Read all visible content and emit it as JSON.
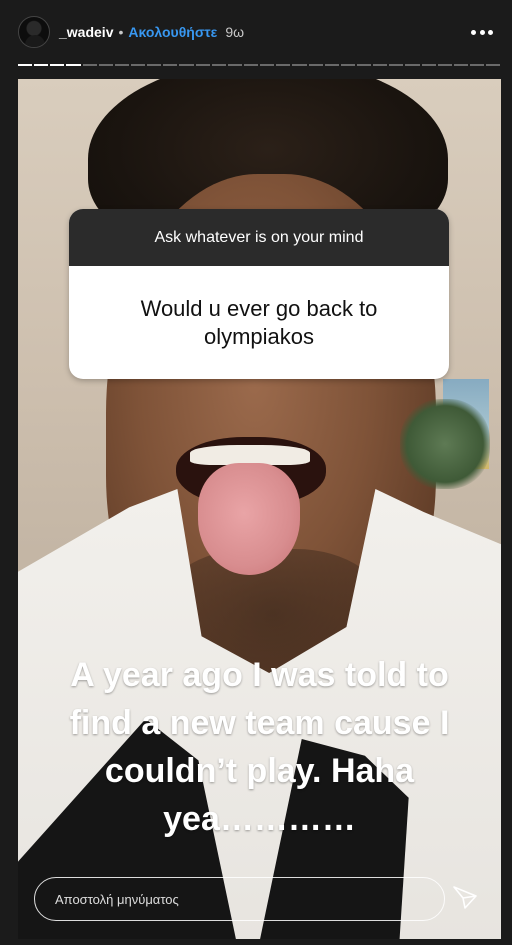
{
  "header": {
    "username": "_wadeiv",
    "separator": "•",
    "follow_label": "Ακολουθήστε",
    "time_ago": "9ω",
    "more_icon": "more-horizontal-icon"
  },
  "progress": {
    "total_segments": 30,
    "completed_segments": 4
  },
  "question_sticker": {
    "prompt": "Ask whatever is on your mind",
    "question_line_1": "Would u ever go back to",
    "question_line_2": "olympiakos"
  },
  "caption": {
    "line_1": "A year ago I was told to",
    "line_2": "find a new team cause I",
    "line_3": "couldn’t play. Haha",
    "line_4": "yea…………"
  },
  "reply": {
    "placeholder": "Αποστολή μηνύματος",
    "send_icon": "send-icon"
  },
  "colors": {
    "background": "#1b1b1b",
    "follow": "#3897f0",
    "sticker_header": "#2b2b2b"
  }
}
